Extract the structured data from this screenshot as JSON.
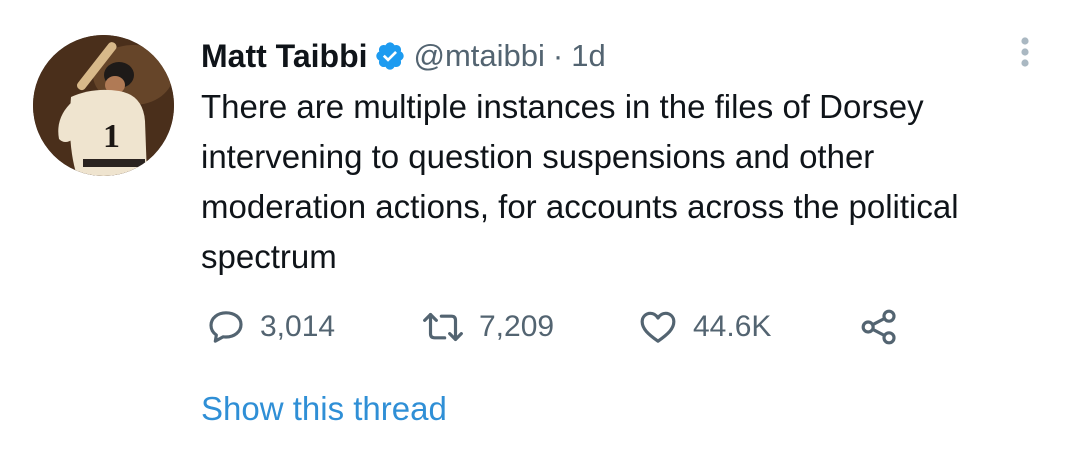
{
  "tweet": {
    "author": {
      "display_name": "Matt Taibbi",
      "handle": "@mtaibbi",
      "verified": true,
      "avatar_icon": "baseball-player-avatar"
    },
    "separator": "·",
    "time": "1d",
    "text": "There are multiple instances in the files of Dorsey intervening to question suspensions and other moderation actions, for accounts across the political spectrum",
    "actions": {
      "reply_count": "3,014",
      "retweet_count": "7,209",
      "like_count": "44.6K"
    },
    "show_thread_label": "Show this thread"
  },
  "colors": {
    "text_primary": "#0f1419",
    "text_secondary": "#536471",
    "link": "#2f8fd6",
    "verified_badge": "#1d9bf0"
  },
  "icons": {
    "more": "more-vertical-icon",
    "reply": "reply-bubble-icon",
    "retweet": "retweet-icon",
    "like": "heart-icon",
    "share": "share-icon",
    "verified": "verified-badge-icon"
  }
}
